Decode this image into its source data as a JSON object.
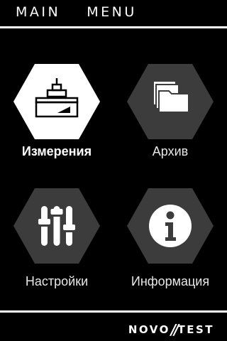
{
  "header": {
    "title": "MAIN  MENU"
  },
  "menu": {
    "items": [
      {
        "label": "Измерения",
        "icon": "measurement-icon",
        "selected": true
      },
      {
        "label": "Архив",
        "icon": "archive-folders-icon",
        "selected": false
      },
      {
        "label": "Настройки",
        "icon": "settings-sliders-icon",
        "selected": false
      },
      {
        "label": "Информация",
        "icon": "info-icon",
        "selected": false
      }
    ]
  },
  "footer": {
    "brand_left": "NOVO",
    "brand_sep": "//",
    "brand_right": "TEST"
  },
  "colors": {
    "background": "#000000",
    "hex_selected": "#ffffff",
    "hex_default": "#3c3c3c",
    "text": "#ffffff"
  }
}
